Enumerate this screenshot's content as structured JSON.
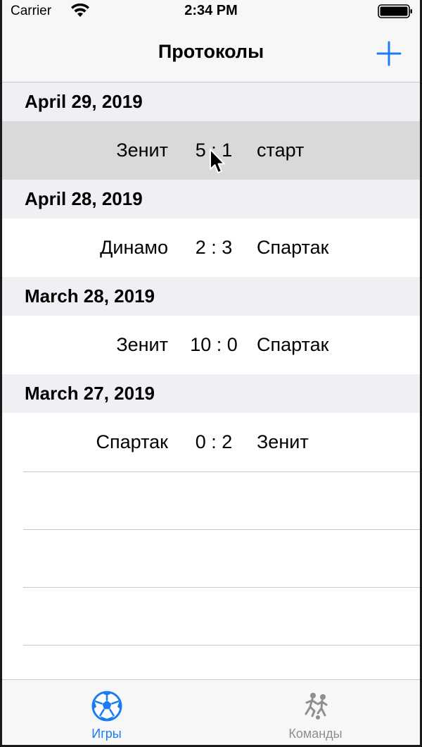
{
  "status_bar": {
    "carrier": "Carrier",
    "time": "2:34 PM",
    "wifi_icon": "wifi-icon",
    "battery_icon": "battery-icon"
  },
  "nav": {
    "title": "Протоколы",
    "add_icon": "plus-icon"
  },
  "sections": [
    {
      "date": "April 29, 2019",
      "games": [
        {
          "home": "Зенит",
          "score": "5 : 1",
          "away": "старт",
          "selected": true
        }
      ]
    },
    {
      "date": "April 28, 2019",
      "games": [
        {
          "home": "Динамо",
          "score": "2 : 3",
          "away": "Спартак",
          "selected": false
        }
      ]
    },
    {
      "date": "March 28, 2019",
      "games": [
        {
          "home": "Зенит",
          "score": "10 : 0",
          "away": "Спартак",
          "selected": false
        }
      ]
    },
    {
      "date": "March 27, 2019",
      "games": [
        {
          "home": "Спартак",
          "score": "0 : 2",
          "away": "Зенит",
          "selected": false
        }
      ]
    }
  ],
  "tabs": [
    {
      "label": "Игры",
      "icon": "soccer-ball-icon",
      "active": true
    },
    {
      "label": "Команды",
      "icon": "players-icon",
      "active": false
    }
  ],
  "colors": {
    "accent": "#1a7cf4",
    "inactive_tab": "#8e8e93",
    "section_bg": "#efeff4",
    "selected_row": "#d9d9d9"
  }
}
